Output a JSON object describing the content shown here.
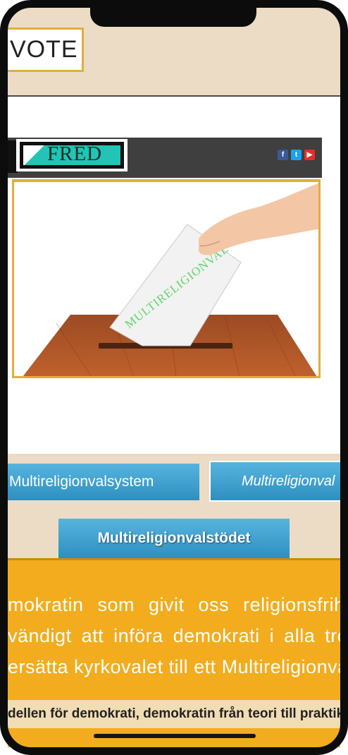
{
  "header": {
    "vote_label": "VOTE"
  },
  "site": {
    "logo_text": "FRED",
    "socials": [
      {
        "name": "facebook",
        "glyph": "f"
      },
      {
        "name": "twitter",
        "glyph": "t"
      },
      {
        "name": "youtube",
        "glyph": "▶"
      }
    ],
    "hero": {
      "ballot_text": "MULTIRELIGIONVAL"
    }
  },
  "nav": {
    "button_1": "Multireligionvalsystem",
    "button_2": "Multireligionval",
    "button_3": "Multireligionvalstödet"
  },
  "content": {
    "lines": [
      "mokratin som givit oss religionsfrihet",
      "vändigt att införa demokrati i alla trossamfund",
      "ersätta kyrkovalet till ett Multireligionval"
    ],
    "ticker": "dellen för demokrati, demokratin från teori till praktik"
  },
  "colors": {
    "gold": "#e2ad3c",
    "beige": "#ecdcc6",
    "orange": "#f2ac1d",
    "button_blue": "#3a9ccc",
    "logo_teal": "#22c4b5"
  }
}
